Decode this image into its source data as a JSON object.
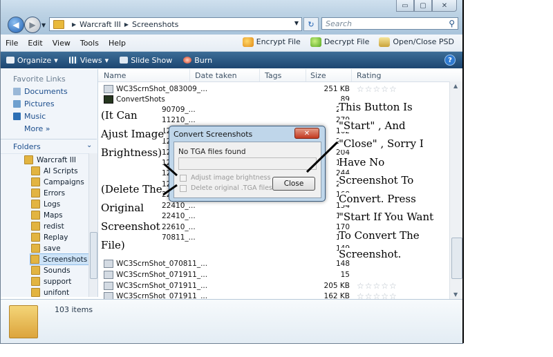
{
  "window": {
    "caption_buttons": {
      "minimize": "▭",
      "maximize": "▢",
      "close": "✕"
    }
  },
  "address_bar": {
    "crumbs": [
      "Warcraft III",
      "Screenshots"
    ],
    "search_placeholder": "Search"
  },
  "menubar": {
    "items": [
      "File",
      "Edit",
      "View",
      "Tools",
      "Help"
    ],
    "actions": [
      "Encrypt File",
      "Decrypt File",
      "Open/Close PSD"
    ]
  },
  "toolbar": {
    "organize": "Organize",
    "views": "Views",
    "slideshow": "Slide Show",
    "burn": "Burn",
    "help": "?"
  },
  "sidebar": {
    "favorites_heading": "Favorite Links",
    "favorites": [
      "Documents",
      "Pictures",
      "Music"
    ],
    "more": "More »",
    "folders_heading": "Folders",
    "tree": [
      "Warcraft III",
      "AI Scripts",
      "Campaigns",
      "Errors",
      "Logs",
      "Maps",
      "redist",
      "Replay",
      "save",
      "Screenshots",
      "Sounds",
      "support",
      "unifont"
    ],
    "selected": "Screenshots"
  },
  "columns": [
    "Name",
    "Date taken",
    "Tags",
    "Size",
    "Rating"
  ],
  "files": [
    {
      "name": "WC3ScrnShot_083009_...",
      "size": "251 KB",
      "stars": "☆☆☆☆☆"
    },
    {
      "name": "ConvertShots",
      "size": "89",
      "stars": ""
    },
    {
      "name": "",
      "size": "222",
      "stars": ""
    },
    {
      "name": "",
      "size": "279",
      "stars": ""
    },
    {
      "name": "",
      "size": "162",
      "stars": ""
    },
    {
      "name": "",
      "size": "211",
      "stars": ""
    },
    {
      "name": "",
      "size": "204",
      "stars": ""
    },
    {
      "name": "",
      "size": "156",
      "stars": ""
    },
    {
      "name": "",
      "size": "244",
      "stars": ""
    },
    {
      "name": "",
      "size": "246",
      "stars": ""
    },
    {
      "name": "",
      "size": "168",
      "stars": ""
    },
    {
      "name": "",
      "size": "154",
      "stars": ""
    },
    {
      "name": "",
      "size": "182",
      "stars": ""
    },
    {
      "name": "",
      "size": "170",
      "stars": ""
    },
    {
      "name": "",
      "size": "164",
      "stars": ""
    },
    {
      "name": "",
      "size": "149",
      "stars": ""
    },
    {
      "name": "WC3ScrnShot_070811_...",
      "size": "148",
      "stars": ""
    },
    {
      "name": "WC3ScrnShot_071911_...",
      "size": "15",
      "stars": ""
    },
    {
      "name": "WC3ScrnShot_071911_...",
      "size": "205 KB",
      "stars": "☆☆☆☆☆"
    },
    {
      "name": "WC3ScrnShot_071911_...",
      "size": "162 KB",
      "stars": "☆☆☆☆☆"
    }
  ],
  "partial_names": [
    "90709_...",
    "11210_...",
    "12...",
    "12...",
    "12...",
    "12...",
    "12...",
    "12...",
    "22110_...",
    "22410_...",
    "22410_...",
    "22610_...",
    "70811_..."
  ],
  "details": {
    "count": "103 items"
  },
  "dialog": {
    "title": "Convert Screenshots",
    "close_glyph": "✕",
    "status": "No TGA files found",
    "checkbox1": "Adjust image brightness",
    "checkbox2": "Delete original .TGA files",
    "button": "Close"
  },
  "annotations": {
    "left_notes": [
      "(It Can",
      "Ajust Image",
      "Brightness)",
      "(Delete The",
      "Original",
      "Screenshot",
      "File)"
    ],
    "right_notes": [
      "This Button Is",
      "\"Start\" , And",
      "\"Close\" , Sorry I",
      "Have No",
      "Screenshot To",
      "Convert. Press",
      "\"Start If You Want",
      "To Convert The",
      "Screenshot."
    ]
  }
}
